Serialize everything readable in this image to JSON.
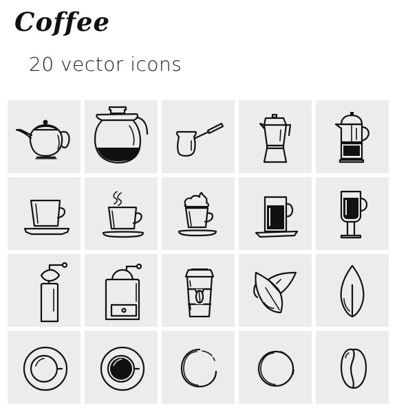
{
  "header": {
    "title": "Coffee",
    "subtitle": "20 vector icons"
  },
  "colors": {
    "tile_background": "#ececec",
    "icon_stroke": "#111111",
    "page_background": "#ffffff"
  },
  "icons": [
    {
      "name": "teapot-icon"
    },
    {
      "name": "coffee-carafe-icon"
    },
    {
      "name": "turkish-cezve-icon"
    },
    {
      "name": "moka-pot-icon"
    },
    {
      "name": "french-press-icon"
    },
    {
      "name": "cup-on-saucer-icon"
    },
    {
      "name": "steaming-cup-icon"
    },
    {
      "name": "whipped-cream-cup-icon"
    },
    {
      "name": "espresso-mug-icon"
    },
    {
      "name": "irish-coffee-glass-icon"
    },
    {
      "name": "pepper-mill-grinder-icon"
    },
    {
      "name": "box-coffee-grinder-icon"
    },
    {
      "name": "takeaway-cup-icon"
    },
    {
      "name": "coffee-leaves-icon"
    },
    {
      "name": "single-leaf-icon"
    },
    {
      "name": "empty-cup-top-view-icon"
    },
    {
      "name": "full-cup-top-view-icon"
    },
    {
      "name": "coffee-ring-stain-open-icon"
    },
    {
      "name": "coffee-ring-stain-closed-icon"
    },
    {
      "name": "coffee-bean-icon"
    }
  ]
}
